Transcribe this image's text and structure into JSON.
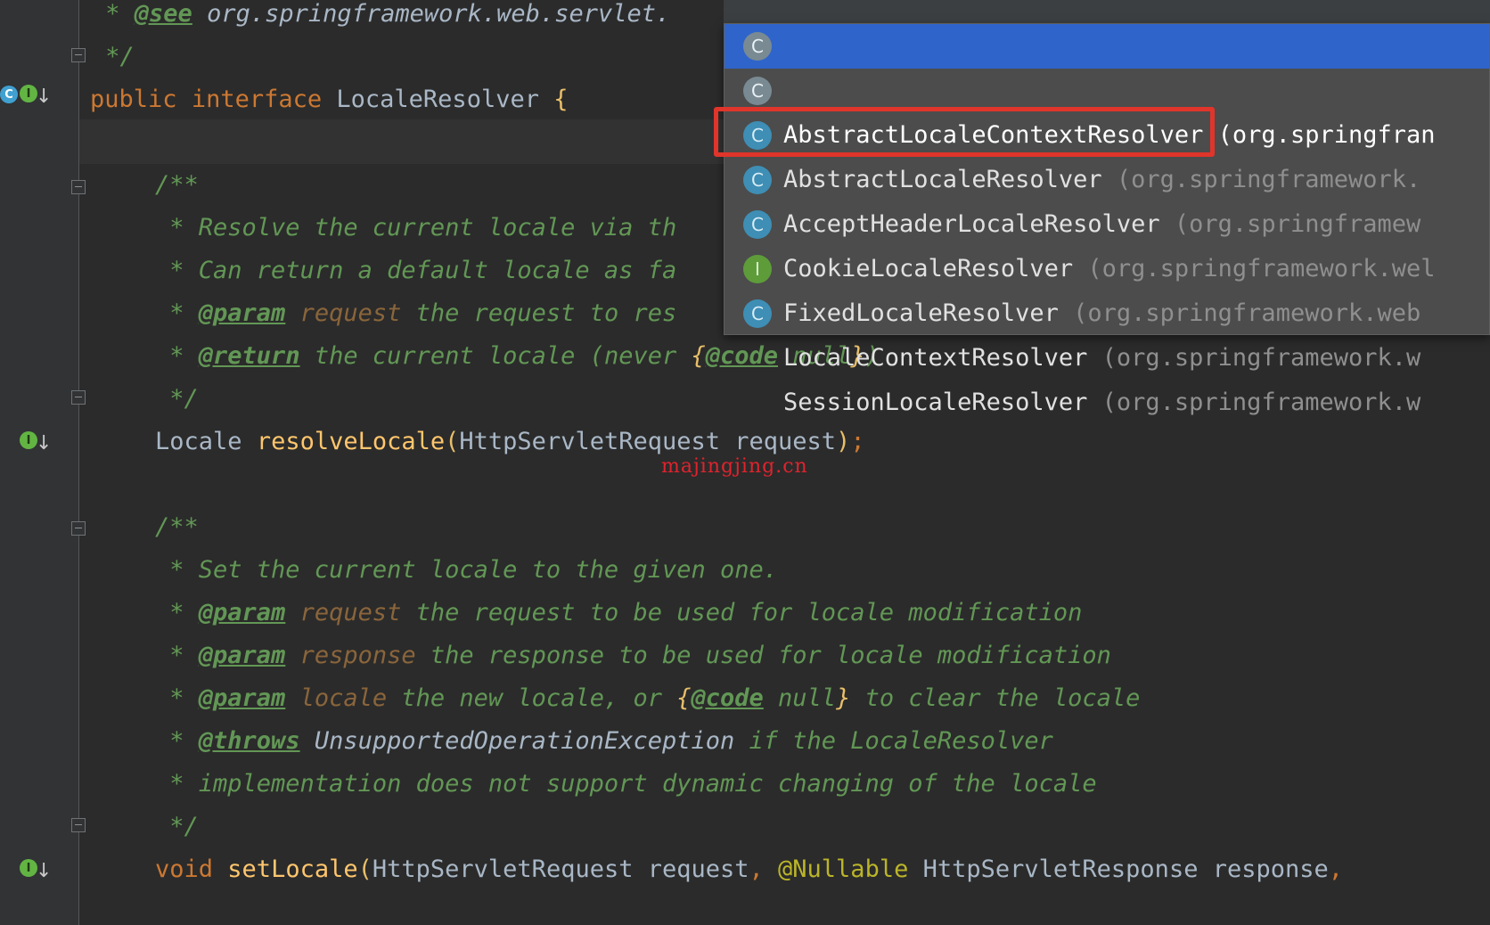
{
  "code": {
    "line_see": {
      "star": " * ",
      "tag": "@see",
      "rest": " org.springframework.web.servlet."
    },
    "line_close1": " */",
    "line_decl": {
      "kw1": "public",
      "kw2": "interface",
      "name": "LocaleResolver",
      "brace": "{"
    },
    "doc1": {
      "open": "/**",
      "l1": " * Resolve the current locale via th",
      "l2": " * Can return a default locale as fa",
      "param": {
        "star": " * ",
        "tag": "@param",
        "name": " request",
        "rest": " the request to res"
      },
      "ret": {
        "star": " * ",
        "tag": "@return",
        "rest": " the current locale (never ",
        "b1": "{",
        "code": "@code",
        "nul": " null",
        "b2": "}",
        "end": ")"
      },
      "close": " */"
    },
    "method1": {
      "type": "Locale",
      "name": "resolveLocale",
      "open": "(",
      "param": "HttpServletRequest request",
      "close": ")",
      "semi": ";"
    },
    "doc2": {
      "open": "/**",
      "l1": " * Set the current locale to the given one.",
      "p1": {
        "star": " * ",
        "tag": "@param",
        "name": " request",
        "rest": " the request to be used for locale modification"
      },
      "p2": {
        "star": " * ",
        "tag": "@param",
        "name": " response",
        "rest": " the response to be used for locale modification"
      },
      "p3": {
        "star": " * ",
        "tag": "@param",
        "name": " locale",
        "rest": " the new locale, or ",
        "b1": "{",
        "code": "@code",
        "nul": " null",
        "b2": "}",
        "end": " to clear the locale"
      },
      "th": {
        "star": " * ",
        "tag": "@throws",
        "ex": " UnsupportedOperationException",
        "rest": " if the LocaleResolver"
      },
      "impl": " * implementation does not support dynamic changing of the locale",
      "close": " */"
    },
    "method2": {
      "kw": "void",
      "name": "setLocale",
      "open": "(",
      "p1": "HttpServletRequest request",
      "comma": ", ",
      "ann": "@Nullable",
      "p2": " HttpServletResponse response",
      "comma2": ", "
    }
  },
  "watermark": "majingjing.cn",
  "completion": {
    "items": [
      {
        "name": "AbstractLocaleContextResolver",
        "pkg": " (org.springfran",
        "icon": "C",
        "selected": true
      },
      {
        "name": "AbstractLocaleResolver",
        "pkg": " (org.springframework.",
        "icon": "C"
      },
      {
        "name": "AcceptHeaderLocaleResolver",
        "pkg": " (org.springframew",
        "icon": "C"
      },
      {
        "name": "CookieLocaleResolver",
        "pkg": " (org.springframework.wel",
        "icon": "C"
      },
      {
        "name": "FixedLocaleResolver",
        "pkg": " (org.springframework.web",
        "icon": "C"
      },
      {
        "name": "LocaleContextResolver",
        "pkg": " (org.springframework.w",
        "icon": "I"
      },
      {
        "name": "SessionLocaleResolver",
        "pkg": " (org.springframework.w",
        "icon": "C"
      }
    ]
  },
  "gutter_icons": {
    "impl": "I",
    "class": "C",
    "arrow": "↓"
  },
  "colors": {
    "background": "#2b2b2b",
    "selection": "#2f65ca",
    "highlight": "#e0352b"
  }
}
